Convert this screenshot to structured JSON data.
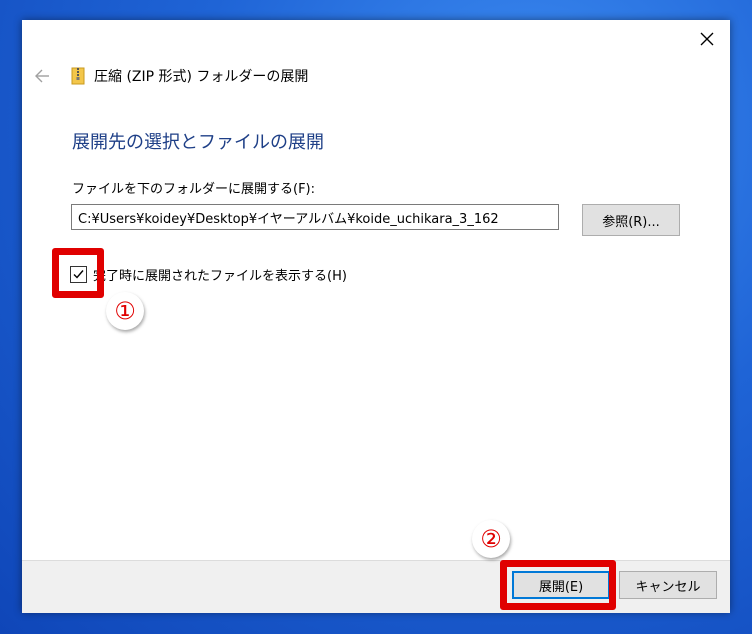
{
  "window": {
    "title": "圧縮 (ZIP 形式) フォルダーの展開",
    "heading": "展開先の選択とファイルの展開"
  },
  "destination": {
    "label": "ファイルを下のフォルダーに展開する(F):",
    "path": "C:¥Users¥koidey¥Desktop¥イヤーアルバム¥koide_uchikara_3_162",
    "browse_label": "参照(R)..."
  },
  "options": {
    "show_files_label": "完了時に展開されたファイルを表示する(H)",
    "show_files_checked": true
  },
  "footer": {
    "extract_label": "展開(E)",
    "cancel_label": "キャンセル"
  },
  "annotations": {
    "step1": "①",
    "step2": "②",
    "highlight_color": "#e00000"
  },
  "icons": {
    "close": "close-icon",
    "back": "back-arrow-icon",
    "zip": "zip-folder-icon",
    "check": "checkmark-icon"
  }
}
